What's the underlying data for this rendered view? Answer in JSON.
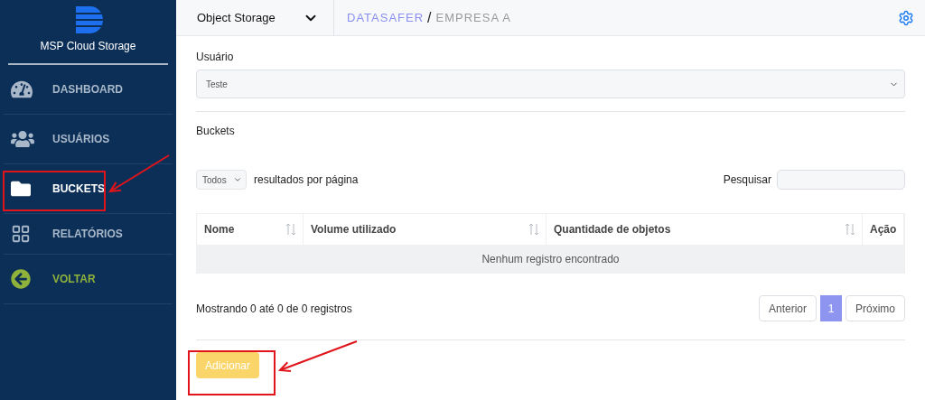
{
  "sidebar": {
    "brand": "MSP Cloud Storage",
    "items": [
      {
        "label": "DASHBOARD",
        "kind": "dashboard",
        "selected": false
      },
      {
        "label": "USUÁRIOS",
        "kind": "users",
        "selected": false
      },
      {
        "label": "BUCKETS",
        "kind": "buckets",
        "selected": true
      },
      {
        "label": "RELATÓRIOS",
        "kind": "reports",
        "selected": false
      },
      {
        "label": "VOLTAR",
        "kind": "back",
        "selected": false
      }
    ]
  },
  "header": {
    "service": "Object Storage",
    "breadcrumb": [
      "DATASAFER",
      "EMPRESA A"
    ],
    "separator": "/"
  },
  "user_field": {
    "label": "Usuário",
    "value": "Teste"
  },
  "section_title": "Buckets",
  "page_size": {
    "value": "Todos",
    "label": "resultados por página"
  },
  "search": {
    "label": "Pesquisar"
  },
  "table": {
    "columns": [
      {
        "label": "Nome",
        "sortable": true
      },
      {
        "label": "Volume utilizado",
        "sortable": true
      },
      {
        "label": "Quantidade de objetos",
        "sortable": true
      },
      {
        "label": "Ação",
        "sortable": false
      }
    ],
    "empty_message": "Nenhum registro encontrado"
  },
  "summary": "Mostrando 0 até 0 de 0 registros",
  "pagination": {
    "previous": "Anterior",
    "pages": [
      {
        "label": "1",
        "selected": true
      }
    ],
    "next": "Próximo"
  },
  "add_button": "Adicionar"
}
